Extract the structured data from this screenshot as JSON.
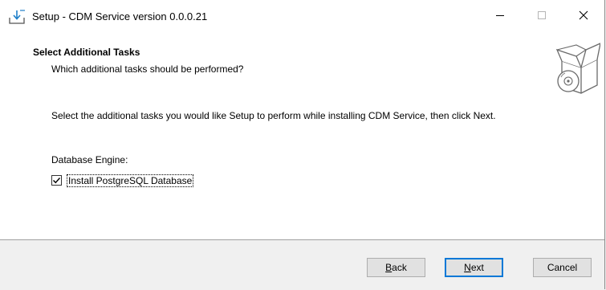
{
  "window": {
    "title": "Setup - CDM Service version 0.0.0.21"
  },
  "icons": {
    "app": "setup-download-icon",
    "minimize": "minimize-icon",
    "maximize": "maximize-icon",
    "close": "close-icon",
    "header": "software-box-icon",
    "checkbox": "checkmark-icon"
  },
  "header": {
    "title": "Select Additional Tasks",
    "subtitle": "Which additional tasks should be performed?"
  },
  "main": {
    "description": "Select the additional tasks you would like Setup to perform while installing CDM Service, then click Next.",
    "group_label": "Database Engine:",
    "tasks": [
      {
        "label": "Install PostgreSQL Database",
        "checked": true
      }
    ]
  },
  "buttons": {
    "back": {
      "accel": "B",
      "rest": "ack"
    },
    "next": {
      "accel": "N",
      "rest": "ext"
    },
    "cancel": "Cancel"
  },
  "colors": {
    "accent": "#0078d7",
    "icon_blue": "#1e7fc9"
  }
}
